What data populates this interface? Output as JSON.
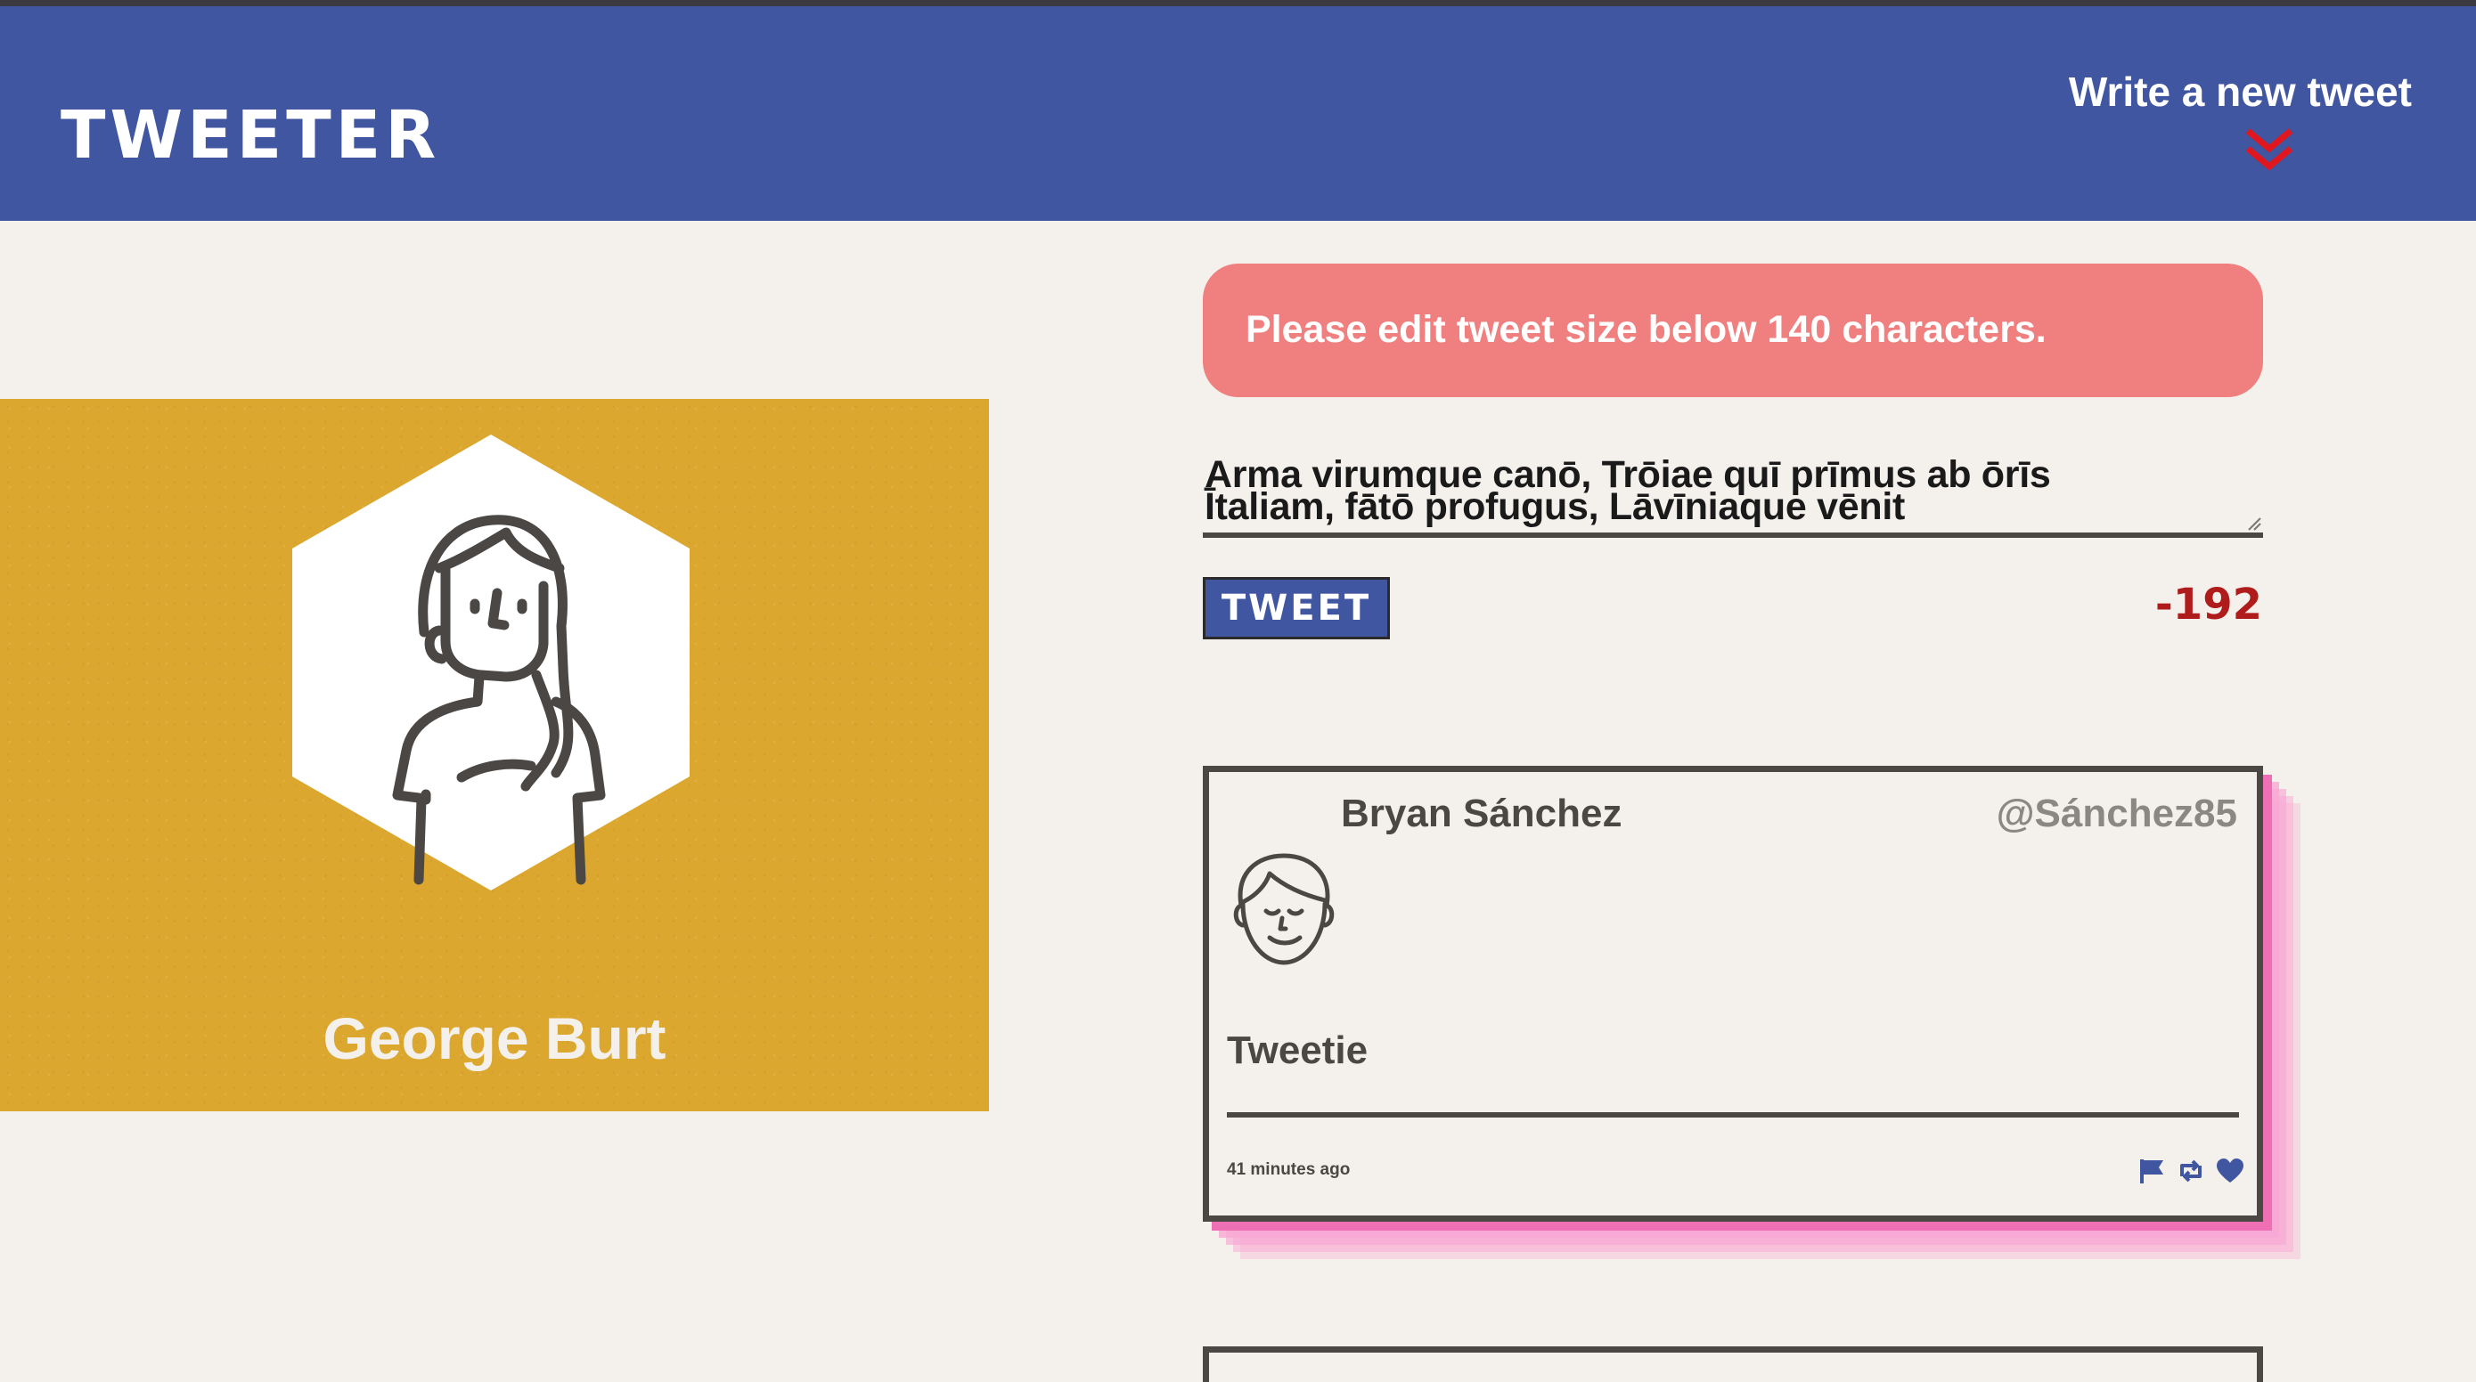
{
  "header": {
    "brand": "TWEETER",
    "compose_label": "Write a new tweet",
    "accent_color": "#e0171e",
    "nav_color": "#4056a1"
  },
  "profile": {
    "name": "George Burt",
    "background_color": "#dca72f",
    "avatar_icon": "woman-avatar-icon"
  },
  "compose": {
    "error_message": "Please edit tweet size below 140 characters.",
    "textarea_line1": "Arma virumque canō, Trōiae quī prīmus ab ōrīs",
    "textarea_line2": "Ītaliam, fātō profugus, Lāvīniaque vēnit",
    "submit_label": "TWEET",
    "char_counter": "-192",
    "counter_color": "#b01c1c"
  },
  "tweets": [
    {
      "author": "Bryan Sánchez",
      "handle": "@Sánchez85",
      "text": "Tweetie",
      "timestamp": "41 minutes ago",
      "avatar_icon": "man-avatar-icon",
      "actions": [
        "flag-icon",
        "retweet-icon",
        "heart-icon"
      ],
      "action_color": "#4056a1",
      "shadow_color": "#f9a8d4"
    }
  ]
}
